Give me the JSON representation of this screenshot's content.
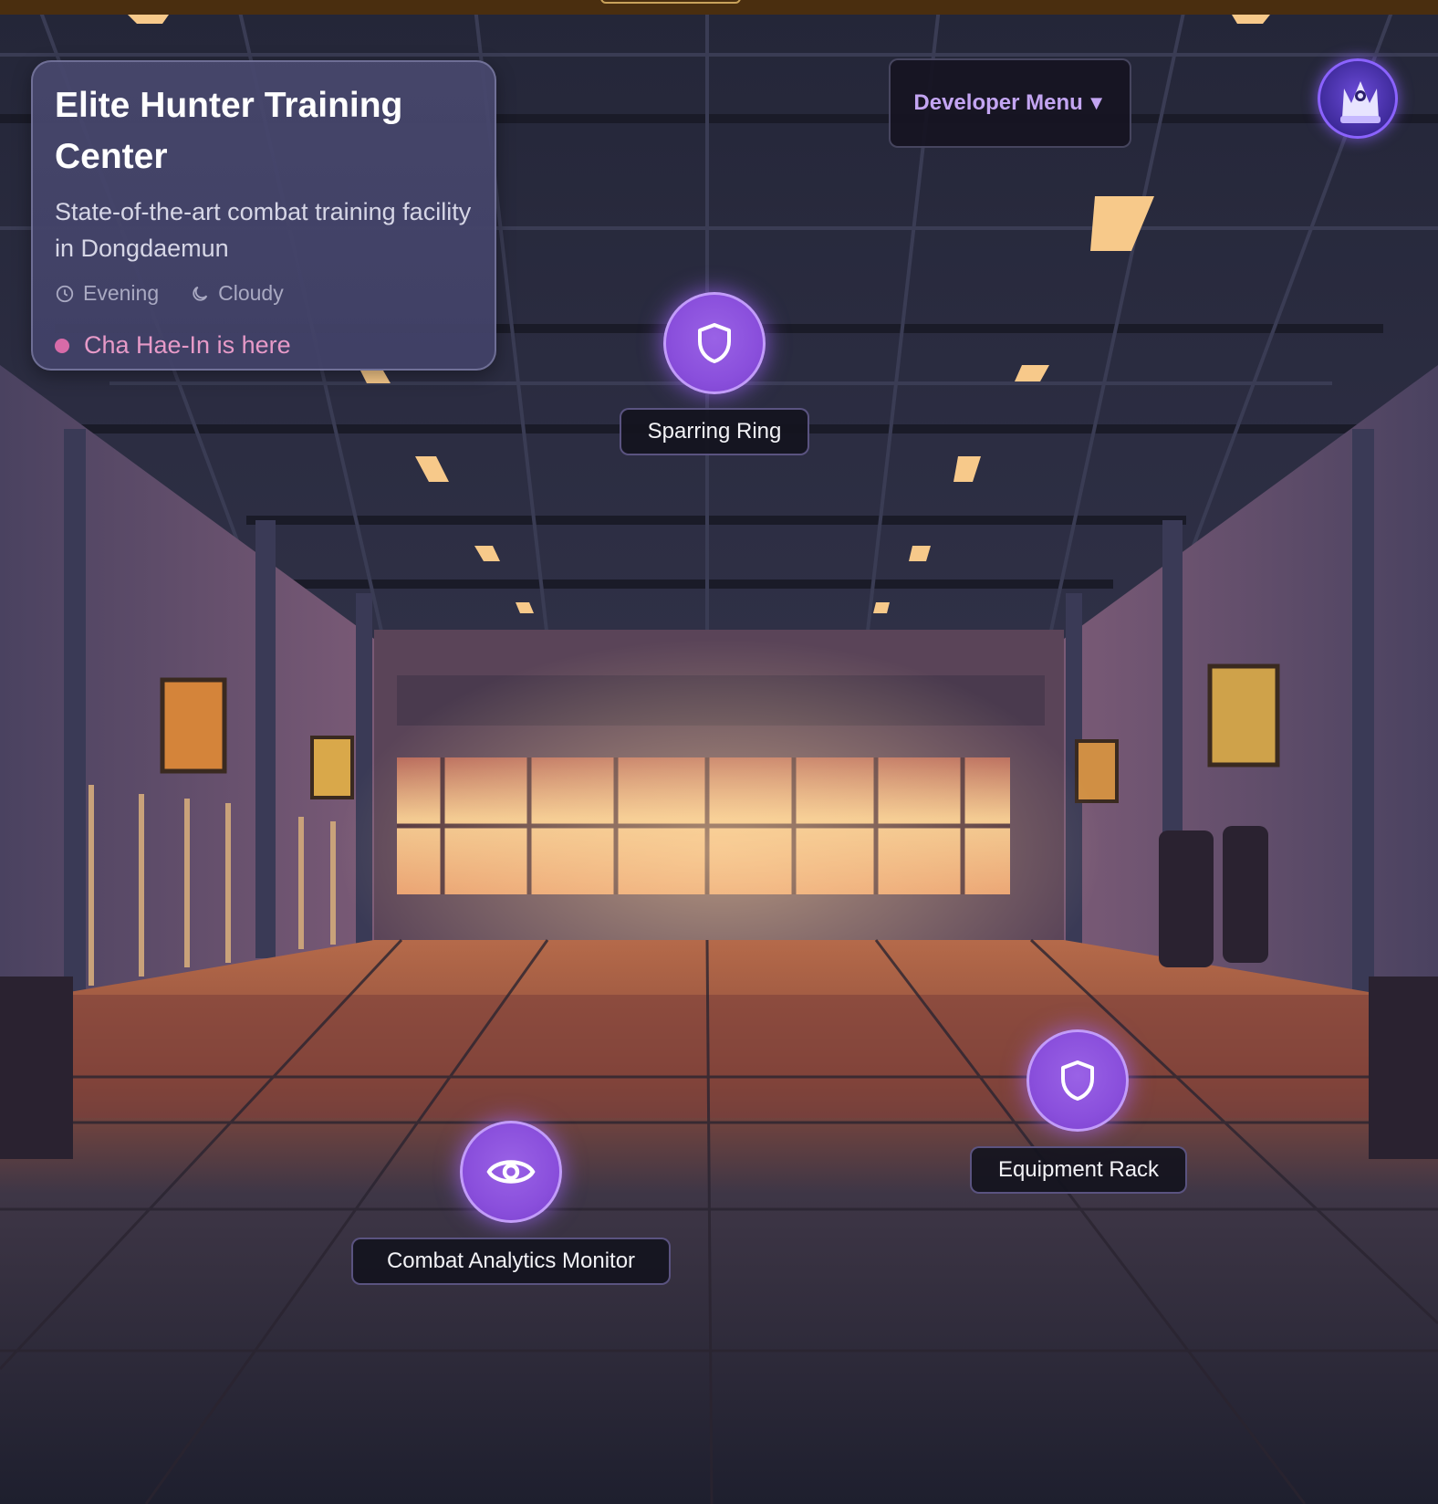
{
  "location": {
    "title": "Elite Hunter Training Center",
    "description": "State-of-the-art combat training facility in Dongdaemun",
    "time_of_day": "Evening",
    "weather": "Cloudy",
    "presence": "Cha Hae-In is here"
  },
  "developer_menu": {
    "label": "Developer Menu",
    "caret": "▼"
  },
  "hotspots": [
    {
      "label": "Sparring Ring",
      "icon": "shield-icon"
    },
    {
      "label": "Equipment Rack",
      "icon": "shield-icon"
    },
    {
      "label": "Combat Analytics Monitor",
      "icon": "eye-icon"
    }
  ],
  "colors": {
    "accent": "#8a4fdc",
    "presence": "#d76ba8",
    "dev_menu_text": "#c3a5f2",
    "top_bar": "#4a2e0f"
  }
}
